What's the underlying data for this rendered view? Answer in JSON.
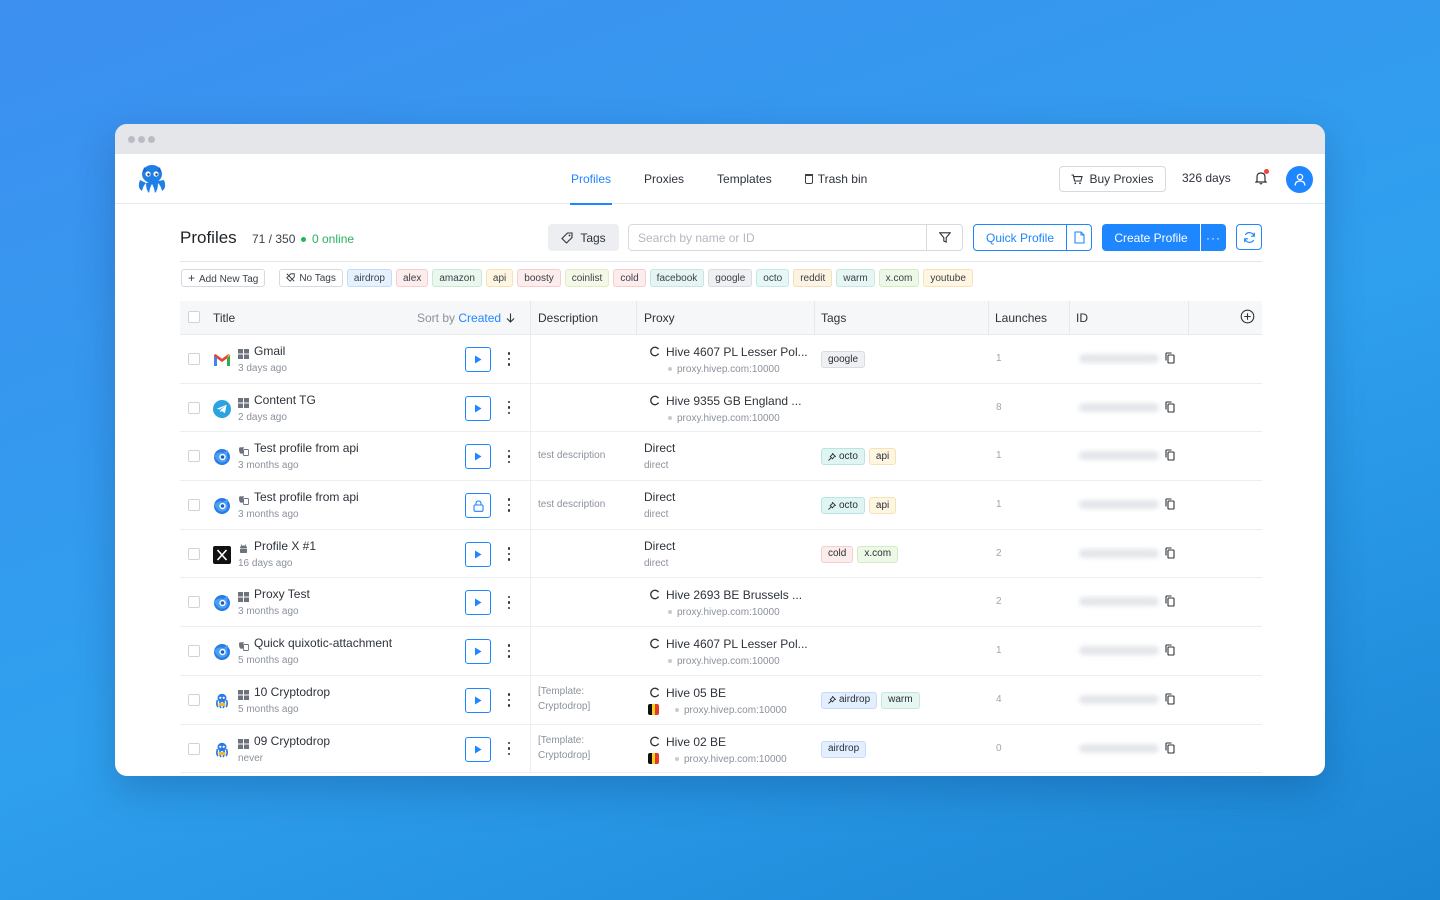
{
  "topbar": {
    "nav": [
      {
        "label": "Profiles",
        "active": true
      },
      {
        "label": "Proxies",
        "active": false
      },
      {
        "label": "Templates",
        "active": false
      },
      {
        "label": "Trash bin",
        "active": false
      }
    ],
    "buy_proxies": "Buy Proxies",
    "days": "326 days"
  },
  "toolbar": {
    "title": "Profiles",
    "count": "71 / 350",
    "online": "0 online",
    "tags_button": "Tags",
    "search_placeholder": "Search by name or ID",
    "quick_profile": "Quick Profile",
    "create_profile": "Create Profile",
    "more": "···"
  },
  "tagbar": {
    "add_new_tag": "Add New Tag",
    "no_tags": "No Tags",
    "tags": [
      {
        "label": "airdrop",
        "bg": "#e6f1ff",
        "border": "#c4dcf8",
        "color": "#3b4148"
      },
      {
        "label": "alex",
        "bg": "#fdecec",
        "border": "#f5cfcf",
        "color": "#3b4148"
      },
      {
        "label": "amazon",
        "bg": "#e9f7ee",
        "border": "#c9e9d3",
        "color": "#3b4148"
      },
      {
        "label": "api",
        "bg": "#fff6e2",
        "border": "#f4e2b8",
        "color": "#3b4148"
      },
      {
        "label": "boosty",
        "bg": "#fdecec",
        "border": "#f5cfcf",
        "color": "#3b4148"
      },
      {
        "label": "coinlist",
        "bg": "#f4f8e6",
        "border": "#e2ebc4",
        "color": "#3b4148"
      },
      {
        "label": "cold",
        "bg": "#fdecec",
        "border": "#f5cfcf",
        "color": "#3b4148"
      },
      {
        "label": "facebook",
        "bg": "#e6f5f3",
        "border": "#c5e6e1",
        "color": "#3b4148"
      },
      {
        "label": "google",
        "bg": "#eff0f2",
        "border": "#d9dce0",
        "color": "#3b4148"
      },
      {
        "label": "octo",
        "bg": "#e5f7f7",
        "border": "#c2e8e8",
        "color": "#3b4148"
      },
      {
        "label": "reddit",
        "bg": "#fdf3e2",
        "border": "#f1dfbd",
        "color": "#3b4148"
      },
      {
        "label": "warm",
        "bg": "#e6f6f3",
        "border": "#c6e7e0",
        "color": "#3b4148"
      },
      {
        "label": "x.com",
        "bg": "#eef8e6",
        "border": "#d5ecc3",
        "color": "#3b4148"
      },
      {
        "label": "youtube",
        "bg": "#fff6e2",
        "border": "#f4e2b8",
        "color": "#3b4148"
      }
    ]
  },
  "table": {
    "columns": {
      "title": "Title",
      "sort_by": "Sort by",
      "sort_field": "Created",
      "description": "Description",
      "proxy": "Proxy",
      "tags": "Tags",
      "launches": "Launches",
      "id": "ID"
    },
    "rows": [
      {
        "icon": "gmail-icon",
        "os": "windows-icon",
        "title": "Gmail",
        "created": "3 days ago",
        "action": "play",
        "description": "",
        "proxy_type": "hive",
        "proxy_name": "Hive 4607 PL Lesser Pol...",
        "proxy_host": "proxy.hivep.com:10000",
        "flag": null,
        "tags": [
          {
            "label": "google",
            "pinned": false,
            "bg": "#eff0f2",
            "border": "#d9dce0"
          }
        ],
        "launches": "1"
      },
      {
        "icon": "telegram-icon",
        "os": "windows-icon",
        "title": "Content TG",
        "created": "2 days ago",
        "action": "play",
        "description": "",
        "proxy_type": "hive",
        "proxy_name": "Hive 9355 GB England ...",
        "proxy_host": "proxy.hivep.com:10000",
        "flag": null,
        "tags": [],
        "launches": "8"
      },
      {
        "icon": "octo-browser-icon",
        "os": "macos-icon",
        "title": "Test profile from api",
        "created": "3 months ago",
        "action": "play",
        "description": "test description",
        "proxy_type": "direct",
        "proxy_name": "Direct",
        "proxy_host": "direct",
        "flag": null,
        "tags": [
          {
            "label": "octo",
            "pinned": true,
            "bg": "#dff5f4",
            "border": "#b8e4e2"
          },
          {
            "label": "api",
            "pinned": false,
            "bg": "#fff6e2",
            "border": "#f4e2b8"
          }
        ],
        "launches": "1"
      },
      {
        "icon": "octo-browser-icon",
        "os": "macos-icon",
        "title": "Test profile from api",
        "created": "3 months ago",
        "action": "lock",
        "description": "test description",
        "proxy_type": "direct",
        "proxy_name": "Direct",
        "proxy_host": "direct",
        "flag": null,
        "tags": [
          {
            "label": "octo",
            "pinned": true,
            "bg": "#dff5f4",
            "border": "#b8e4e2"
          },
          {
            "label": "api",
            "pinned": false,
            "bg": "#fff6e2",
            "border": "#f4e2b8"
          }
        ],
        "launches": "1"
      },
      {
        "icon": "x-icon",
        "os": "android-icon",
        "title": "Profile X #1",
        "created": "16 days ago",
        "action": "play",
        "description": "",
        "proxy_type": "direct",
        "proxy_name": "Direct",
        "proxy_host": "direct",
        "flag": null,
        "tags": [
          {
            "label": "cold",
            "pinned": false,
            "bg": "#fdecec",
            "border": "#f5cfcf"
          },
          {
            "label": "x.com",
            "pinned": false,
            "bg": "#eef8e6",
            "border": "#d5ecc3"
          }
        ],
        "launches": "2"
      },
      {
        "icon": "octo-browser-icon",
        "os": "windows-icon",
        "title": "Proxy Test",
        "created": "3 months ago",
        "action": "play",
        "description": "",
        "proxy_type": "hive",
        "proxy_name": "Hive 2693 BE Brussels ...",
        "proxy_host": "proxy.hivep.com:10000",
        "flag": null,
        "tags": [],
        "launches": "2"
      },
      {
        "icon": "octo-browser-icon",
        "os": "macos-icon",
        "title": "Quick quixotic-attachment",
        "created": "5 months ago",
        "action": "play",
        "description": "",
        "proxy_type": "hive",
        "proxy_name": "Hive 4607 PL Lesser Pol...",
        "proxy_host": "proxy.hivep.com:10000",
        "flag": null,
        "tags": [],
        "launches": "1"
      },
      {
        "icon": "octopus-icon",
        "os": "windows-icon",
        "title": "10 Cryptodrop",
        "created": "5 months ago",
        "action": "play",
        "description": "[Template:\nCryptodrop]",
        "proxy_type": "hive",
        "proxy_name": "Hive 05 BE",
        "proxy_host": "proxy.hivep.com:10000",
        "flag": "belgium",
        "tags": [
          {
            "label": "airdrop",
            "pinned": true,
            "bg": "#e3efff",
            "border": "#c4dcf8"
          },
          {
            "label": "warm",
            "pinned": false,
            "bg": "#e6f6f3",
            "border": "#c6e7e0"
          }
        ],
        "launches": "4"
      },
      {
        "icon": "octopus-icon",
        "os": "windows-icon",
        "title": "09 Cryptodrop",
        "created": "never",
        "action": "play",
        "description": "[Template:\nCryptodrop]",
        "proxy_type": "hive",
        "proxy_name": "Hive 02 BE",
        "proxy_host": "proxy.hivep.com:10000",
        "flag": "belgium",
        "tags": [
          {
            "label": "airdrop",
            "pinned": false,
            "bg": "#e3efff",
            "border": "#c4dcf8"
          }
        ],
        "launches": "0"
      }
    ]
  },
  "colors": {
    "accent": "#1e86ff",
    "online": "#27b35a",
    "notification": "#f0433a"
  }
}
